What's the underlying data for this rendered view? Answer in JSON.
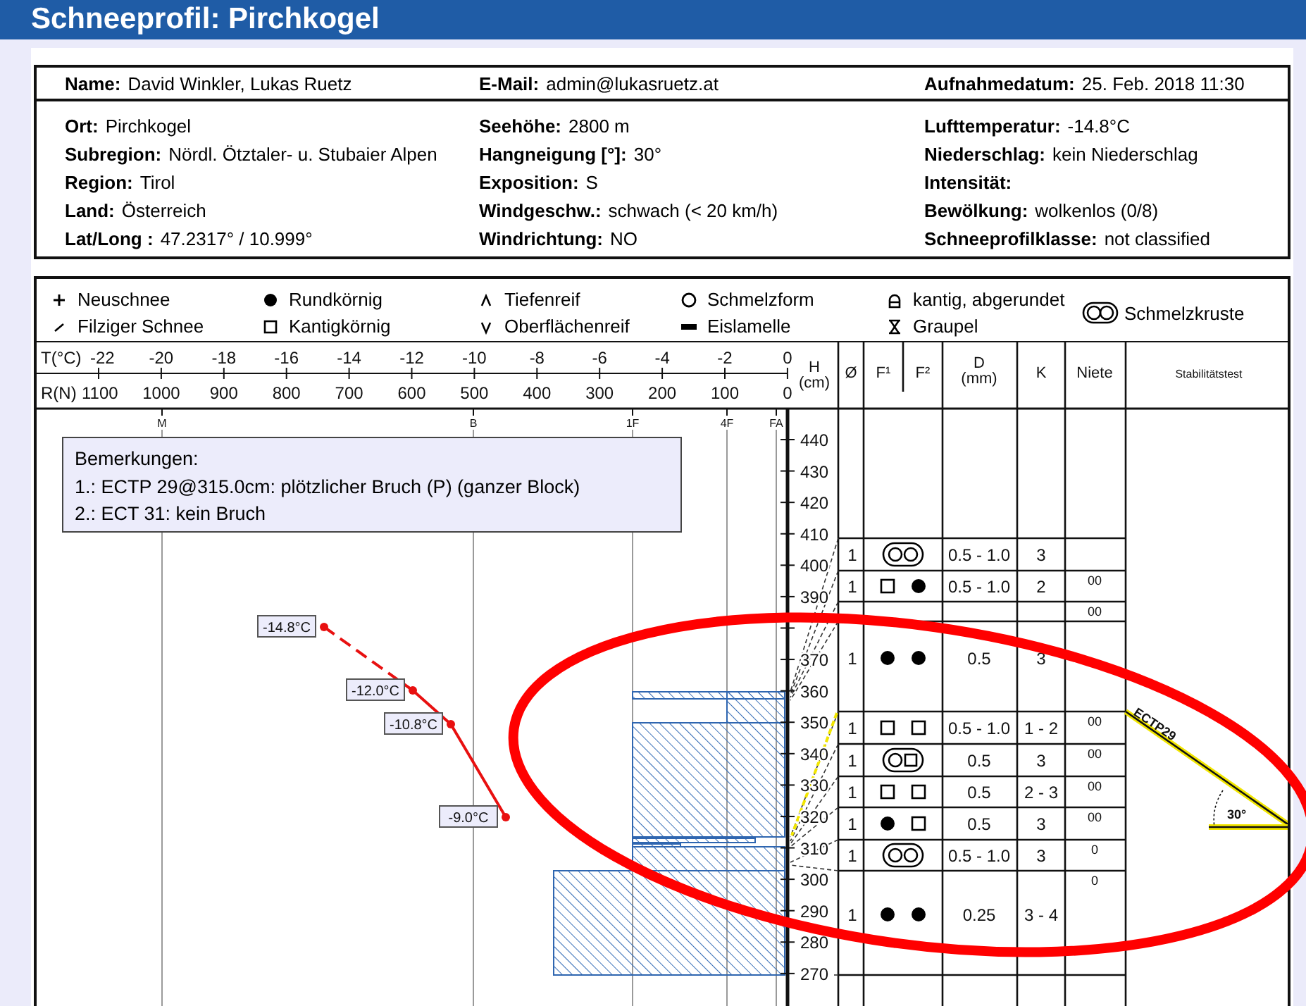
{
  "title": "Schneeprofil: Pirchkogel",
  "header": {
    "top_row": [
      {
        "label": "Name:",
        "value": "David Winkler, Lukas Ruetz"
      },
      {
        "label": "E-Mail:",
        "value": "admin@lukasruetz.at"
      },
      {
        "label": "Aufnahmedatum:",
        "value": "25. Feb. 2018 11:30"
      }
    ],
    "columns": [
      [
        {
          "label": "Ort:",
          "value": "Pirchkogel"
        },
        {
          "label": "Subregion:",
          "value": "Nördl. Ötztaler- u. Stubaier Alpen"
        },
        {
          "label": "Region:",
          "value": "Tirol"
        },
        {
          "label": "Land:",
          "value": "Österreich"
        },
        {
          "label": "Lat/Long :",
          "value": "47.2317° / 10.999°"
        }
      ],
      [
        {
          "label": "Seehöhe:",
          "value": "2800 m"
        },
        {
          "label": "Hangneigung [°]:",
          "value": "30°"
        },
        {
          "label": "Exposition:",
          "value": "S"
        },
        {
          "label": "Windgeschw.:",
          "value": "schwach (< 20 km/h)"
        },
        {
          "label": "Windrichtung:",
          "value": "NO"
        }
      ],
      [
        {
          "label": "Lufttemperatur:",
          "value": "-14.8°C"
        },
        {
          "label": "Niederschlag:",
          "value": "kein Niederschlag"
        },
        {
          "label": "Intensität:"
        },
        {
          "label": "Bewölkung:",
          "value": "wolkenlos (0/8)"
        },
        {
          "label": "Schneeprofilklasse:",
          "value": "not classified"
        }
      ]
    ]
  },
  "legend": [
    {
      "kind": "plus",
      "label": "Neuschnee"
    },
    {
      "kind": "dot",
      "label": "Rundkörnig"
    },
    {
      "kind": "caret",
      "label": "Tiefenreif"
    },
    {
      "kind": "circle",
      "label": "Schmelzform"
    },
    {
      "kind": "rounded",
      "label": "kantig, abgerundet"
    },
    {
      "kind": "melt_crust",
      "label": "Schmelzkruste"
    },
    {
      "kind": "slash",
      "label": "Filziger Schnee"
    },
    {
      "kind": "square",
      "label": "Kantigkörnig"
    },
    {
      "kind": "vee",
      "label": "Oberflächenreif"
    },
    {
      "kind": "bar",
      "label": "Eislamelle"
    },
    {
      "kind": "graupel",
      "label": "Graupel"
    }
  ],
  "axes": {
    "t_label": "T(°C)",
    "t_ticks": [
      "-22",
      "-20",
      "-18",
      "-16",
      "-14",
      "-12",
      "-10",
      "-8",
      "-6",
      "-4",
      "-2",
      "0"
    ],
    "r_label": "R(N)",
    "r_ticks": [
      "1100",
      "1000",
      "900",
      "800",
      "700",
      "600",
      "500",
      "400",
      "300",
      "200",
      "100",
      "0"
    ],
    "hardness_ticks": [
      "M",
      "B",
      "1F",
      "4F",
      "FA"
    ],
    "height_heading": [
      "H",
      "(cm)"
    ],
    "height_ticks": [
      "440",
      "430",
      "420",
      "410",
      "400",
      "390",
      "370",
      "360",
      "350",
      "340",
      "330",
      "320",
      "310",
      "300",
      "290",
      "280",
      "270"
    ]
  },
  "table": {
    "columns": [
      [
        "Ø"
      ],
      [
        "F¹"
      ],
      [
        "F²"
      ],
      [
        "D",
        "(mm)"
      ],
      [
        "K"
      ],
      [
        "Niete"
      ],
      [
        "Stabilitätstest"
      ]
    ],
    "rows": [
      {
        "wetness": "1",
        "grains": [
          {
            "kind": "melt_crust"
          }
        ],
        "d": "0.5 - 1.0",
        "k": "3"
      },
      {
        "wetness": "1",
        "grains": [
          {
            "kind": "faceted"
          },
          {
            "kind": "rounded"
          }
        ],
        "d": "0.5 - 1.0",
        "k": "2",
        "niete": "00"
      },
      {
        "niete": "00"
      },
      {
        "wetness": "1",
        "grains": [
          {
            "kind": "rounded"
          },
          {
            "kind": "rounded"
          }
        ],
        "d": "0.5",
        "k": "3"
      },
      {
        "wetness": "1",
        "grains": [
          {
            "kind": "faceted"
          },
          {
            "kind": "faceted"
          }
        ],
        "d": "0.5 - 1.0",
        "k": "1 - 2",
        "niete": "00"
      },
      {
        "wetness": "1",
        "grains": [
          {
            "kind": "melt_crust_faceted"
          }
        ],
        "d": "0.5",
        "k": "3",
        "niete": "00"
      },
      {
        "wetness": "1",
        "grains": [
          {
            "kind": "faceted"
          },
          {
            "kind": "faceted"
          }
        ],
        "d": "0.5",
        "k": "2 - 3",
        "niete": "00"
      },
      {
        "wetness": "1",
        "grains": [
          {
            "kind": "rounded"
          },
          {
            "kind": "faceted"
          }
        ],
        "d": "0.5",
        "k": "3",
        "niete": "00"
      },
      {
        "wetness": "1",
        "grains": [
          {
            "kind": "melt_crust"
          }
        ],
        "d": "0.5 - 1.0",
        "k": "3",
        "niete": "0"
      },
      {
        "wetness": "1",
        "grains": [
          {
            "kind": "rounded"
          },
          {
            "kind": "rounded"
          }
        ],
        "d": "0.25",
        "k": "3 - 4",
        "niete": "0"
      }
    ]
  },
  "remarks": {
    "title": "Bemerkungen:",
    "lines": [
      "1.: ECTP 29@315.0cm: plötzlicher Bruch (P) (ganzer Block)",
      "2.: ECT 31: kein Bruch"
    ]
  },
  "temperatures": [
    {
      "label": "-14.8°C"
    },
    {
      "label": "-12.0°C"
    },
    {
      "label": "-10.8°C"
    },
    {
      "label": "-9.0°C"
    }
  ],
  "stability_test": {
    "label": "ECTP29",
    "angle": "30°"
  }
}
